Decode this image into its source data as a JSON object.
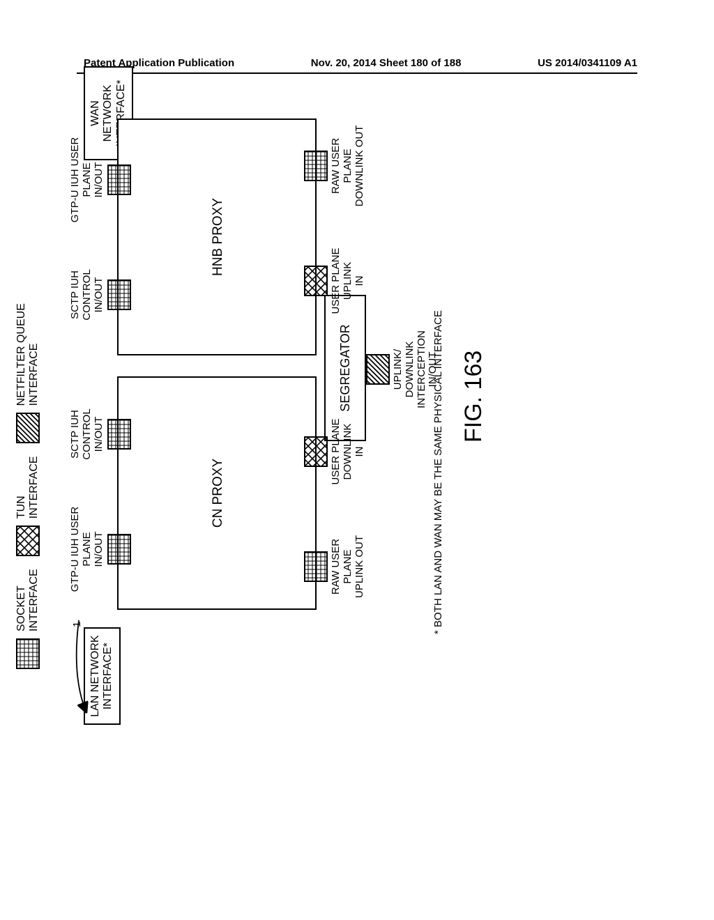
{
  "header": {
    "left": "Patent Application Publication",
    "center": "Nov. 20, 2014  Sheet 180 of 188",
    "right": "US 2014/0341109 A1"
  },
  "legend": {
    "socket": "SOCKET\nINTERFACE",
    "tun": "TUN\nINTERFACE",
    "netfilter": "NETFILTER QUEUE\nINTERFACE"
  },
  "boxes": {
    "lan": "LAN NETWORK\nINTERFACE*",
    "wan": "WAN\nNETWORK\nINTERFACE*",
    "ref1": "1",
    "cn_proxy": "CN PROXY",
    "hnb_proxy": "HNB PROXY",
    "segregator": "SEGREGATOR"
  },
  "ports": {
    "cn_gtpu": "GTP-U IUH USER\nPLANE\nIN/OUT",
    "cn_sctp": "SCTP IUH\nCONTROL\nIN/OUT",
    "cn_raw_uplink": "RAW USER\nPLANE\nUPLINK OUT",
    "cn_user_dnlink": "USER PLANE\nDOWNLINK\nIN",
    "hnb_sctp": "SCTP IUH\nCONTROL\nIN/OUT",
    "hnb_gtpu": "GTP-U IUH USER\nPLANE\nIN/OUT",
    "hnb_user_uplink": "USER PLANE\nUPLINK\nIN",
    "hnb_raw_dnlink": "RAW USER\nPLANE\nDOWNLINK OUT",
    "seg_intercept": "UPLINK/\nDOWNLINK\nINTERCEPTION\nIN/OUT"
  },
  "footnote": "* BOTH LAN AND WAN MAY BE THE SAME PHYSICAL INTERFACE",
  "figure": "FIG. 163"
}
